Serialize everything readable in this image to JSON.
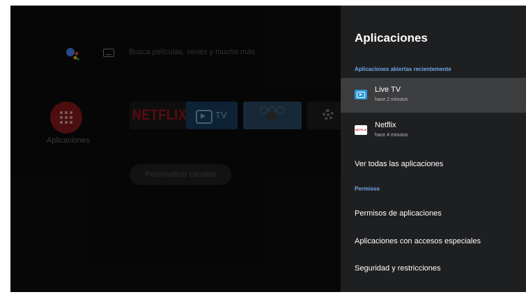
{
  "home": {
    "search_placeholder": "Busca películas, series y mucho más",
    "apps_label": "Aplicaciones",
    "tiles": {
      "netflix_label": "NETFLIX",
      "tv_label": "TV"
    },
    "personalize_label": "Personalizar canales"
  },
  "panel": {
    "title": "Aplicaciones",
    "recent_section": "Aplicaciones abiertas recientemente",
    "recent_apps": [
      {
        "name": "Live TV",
        "time": "hace 2 minutos",
        "icon": "live-tv-icon"
      },
      {
        "name": "Netflix",
        "time": "hace 4 minutos",
        "icon": "netflix-icon",
        "icon_text": "NETFLIX"
      }
    ],
    "see_all": "Ver todas las aplicaciones",
    "permissions_section": "Permisos",
    "permissions_items": [
      "Permisos de aplicaciones",
      "Aplicaciones con accesos especiales",
      "Seguridad y restricciones"
    ]
  },
  "colors": {
    "panel_bg": "#1e1f21",
    "section_accent": "#6fa8e8",
    "selected_row": "#3c3d3f"
  }
}
